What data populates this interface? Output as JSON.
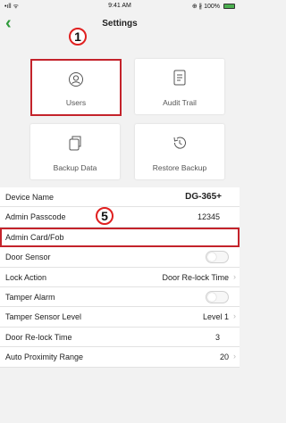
{
  "status_bar": {
    "signal": "•ıll ᯤ",
    "time": "9:41 AM",
    "battery": "⊕ ∦ 100%",
    "battery_level": 1.0
  },
  "nav": {
    "title": "Settings",
    "back_icon": "chevron-left-icon"
  },
  "callouts": {
    "one": "1",
    "five": "5"
  },
  "tiles": [
    {
      "label": "Users",
      "icon": "user-circle-icon",
      "selected": true
    },
    {
      "label": "Audit Trail",
      "icon": "document-icon",
      "selected": false
    },
    {
      "label": "Backup Data",
      "icon": "copy-icon",
      "selected": false
    },
    {
      "label": "Restore Backup",
      "icon": "history-icon",
      "selected": false
    }
  ],
  "settings": [
    {
      "label": "Device Name",
      "value": "DG-365+"
    },
    {
      "label": "Admin Passcode",
      "value": "12345"
    },
    {
      "label": "Admin Card/Fob"
    },
    {
      "label": "Door Sensor",
      "toggle": false
    },
    {
      "label": "Lock Action",
      "value": "Door Re-lock Time"
    },
    {
      "label": "Tamper Alarm",
      "toggle": false
    },
    {
      "label": "Tamper Sensor Level",
      "value": "Level 1"
    },
    {
      "label": "Door Re-lock Time",
      "value": "3"
    },
    {
      "label": "Auto Proximity Range",
      "value": "20"
    }
  ],
  "colors": {
    "accent": "#2e9a3a",
    "highlight": "#c4232b"
  }
}
